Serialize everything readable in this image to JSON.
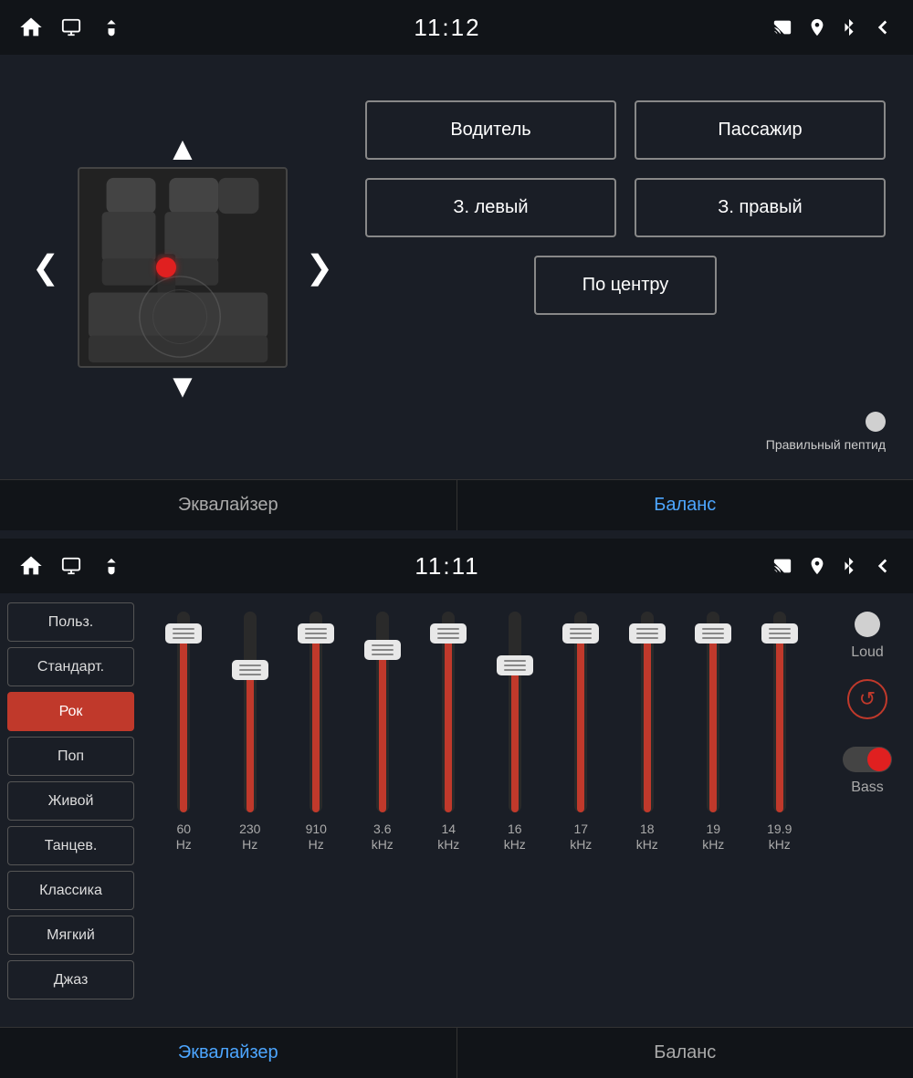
{
  "top_status_bar": {
    "time": "11:12"
  },
  "bottom_status_bar": {
    "time": "11:11"
  },
  "top_tabs": {
    "equalizer": "Эквалайзер",
    "balance": "Баланс"
  },
  "bottom_tabs": {
    "equalizer": "Эквалайзер",
    "balance": "Баланс"
  },
  "seat_buttons": {
    "driver": "Водитель",
    "passenger": "Пассажир",
    "rear_left": "З. левый",
    "rear_right": "З. правый",
    "center": "По центру"
  },
  "peptide_label": "Правильный пептид",
  "eq_presets": [
    {
      "label": "Польз.",
      "selected": false
    },
    {
      "label": "Стандарт.",
      "selected": false
    },
    {
      "label": "Рок",
      "selected": true
    },
    {
      "label": "Поп",
      "selected": false
    },
    {
      "label": "Живой",
      "selected": false
    },
    {
      "label": "Танцев.",
      "selected": false
    },
    {
      "label": "Классика",
      "selected": false
    },
    {
      "label": "Мягкий",
      "selected": false
    },
    {
      "label": "Джаз",
      "selected": false
    }
  ],
  "eq_sliders": [
    {
      "freq": "60",
      "unit": "Hz",
      "fill_pct": 88,
      "thumb_top_pct": 6
    },
    {
      "freq": "230",
      "unit": "Hz",
      "fill_pct": 70,
      "thumb_top_pct": 24
    },
    {
      "freq": "910",
      "unit": "Hz",
      "fill_pct": 88,
      "thumb_top_pct": 6
    },
    {
      "freq": "3.6",
      "unit": "kHz",
      "fill_pct": 80,
      "thumb_top_pct": 14
    },
    {
      "freq": "14",
      "unit": "kHz",
      "fill_pct": 88,
      "thumb_top_pct": 6
    },
    {
      "freq": "16",
      "unit": "kHz",
      "fill_pct": 72,
      "thumb_top_pct": 22
    },
    {
      "freq": "17",
      "unit": "kHz",
      "fill_pct": 88,
      "thumb_top_pct": 6
    },
    {
      "freq": "18",
      "unit": "kHz",
      "fill_pct": 88,
      "thumb_top_pct": 6
    },
    {
      "freq": "19",
      "unit": "kHz",
      "fill_pct": 88,
      "thumb_top_pct": 6
    },
    {
      "freq": "19.9",
      "unit": "kHz",
      "fill_pct": 88,
      "thumb_top_pct": 6
    }
  ],
  "loud_label": "Loud",
  "bass_label": "Bass",
  "nav_arrows": {
    "up": "▲",
    "down": "▼",
    "left": "❮",
    "right": "❯"
  }
}
